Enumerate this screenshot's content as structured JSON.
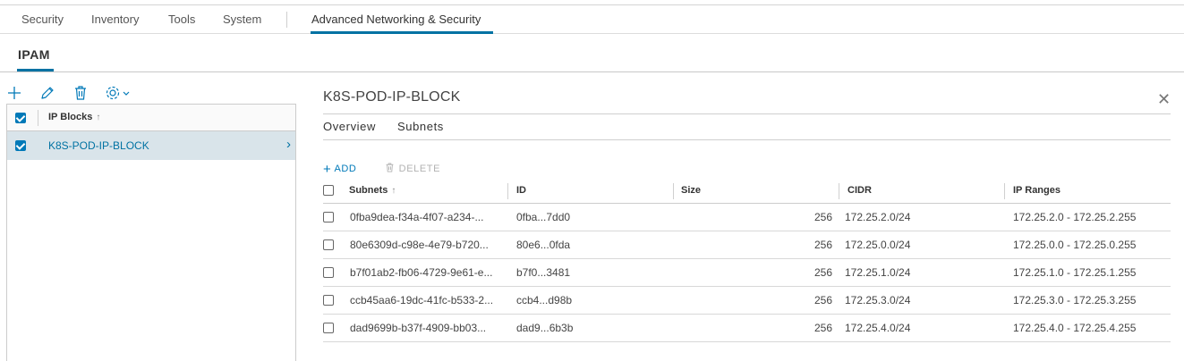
{
  "top_nav": {
    "items": [
      "Security",
      "Inventory",
      "Tools",
      "System"
    ],
    "active": "Advanced Networking & Security"
  },
  "sub_nav": {
    "active": "IPAM"
  },
  "left_panel": {
    "toolbar_icons": [
      "add-icon",
      "edit-icon",
      "delete-icon",
      "settings-icon"
    ],
    "column_header": "IP Blocks",
    "rows": [
      {
        "label": "K8S-POD-IP-BLOCK",
        "selected": true
      }
    ]
  },
  "detail": {
    "title": "K8S-POD-IP-BLOCK",
    "tabs": [
      "Overview",
      "Subnets"
    ],
    "actions": {
      "add": "ADD",
      "delete": "DELETE"
    },
    "columns": [
      "Subnets",
      "ID",
      "Size",
      "CIDR",
      "IP Ranges"
    ],
    "rows": [
      {
        "subnet": "0fba9dea-f34a-4f07-a234-...",
        "id": "0fba...7dd0",
        "size": "256",
        "cidr": "172.25.2.0/24",
        "range": "172.25.2.0 - 172.25.2.255"
      },
      {
        "subnet": "80e6309d-c98e-4e79-b720...",
        "id": "80e6...0fda",
        "size": "256",
        "cidr": "172.25.0.0/24",
        "range": "172.25.0.0 - 172.25.0.255"
      },
      {
        "subnet": "b7f01ab2-fb06-4729-9e61-e...",
        "id": "b7f0...3481",
        "size": "256",
        "cidr": "172.25.1.0/24",
        "range": "172.25.1.0 - 172.25.1.255"
      },
      {
        "subnet": "ccb45aa6-19dc-41fc-b533-2...",
        "id": "ccb4...d98b",
        "size": "256",
        "cidr": "172.25.3.0/24",
        "range": "172.25.3.0 - 172.25.3.255"
      },
      {
        "subnet": "dad9699b-b37f-4909-bb03...",
        "id": "dad9...6b3b",
        "size": "256",
        "cidr": "172.25.4.0/24",
        "range": "172.25.4.0 - 172.25.4.255"
      }
    ]
  },
  "colors": {
    "accent": "#0079b8",
    "selected_row": "#d9e4ea",
    "link": "#0072a3"
  }
}
